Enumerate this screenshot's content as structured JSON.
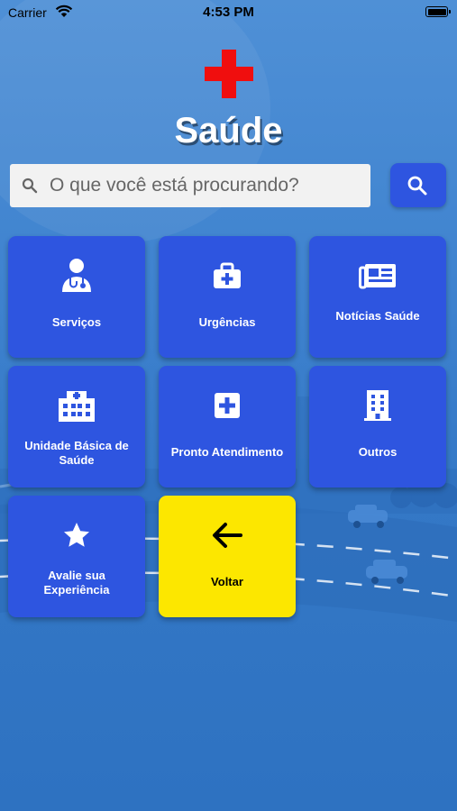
{
  "status_bar": {
    "carrier": "Carrier",
    "time": "4:53 PM"
  },
  "app": {
    "title": "Saúde"
  },
  "search": {
    "placeholder": "O que você está procurando?"
  },
  "colors": {
    "tile": "#2e55e0",
    "back_tile": "#fce700",
    "logo_cross": "#f00e0e"
  },
  "tiles": [
    {
      "label": "Serviços",
      "icon": "doctor-icon"
    },
    {
      "label": "Urgências",
      "icon": "medical-kit-icon"
    },
    {
      "label": "Notícias Saúde",
      "icon": "newspaper-icon"
    },
    {
      "label": "Unidade Básica de Saúde",
      "icon": "hospital-icon"
    },
    {
      "label": "Pronto Atendimento",
      "icon": "medical-cross-icon"
    },
    {
      "label": "Outros",
      "icon": "building-icon"
    },
    {
      "label": "Avalie sua Experiência",
      "icon": "star-icon"
    },
    {
      "label": "Voltar",
      "icon": "arrow-left-icon"
    }
  ]
}
